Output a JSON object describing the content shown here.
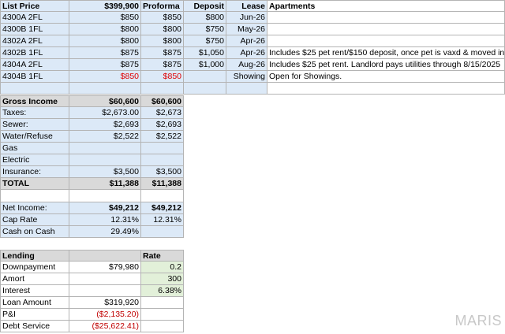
{
  "header": {
    "list_price_label": "List Price",
    "list_price": "$399,900",
    "proforma": "Proforma",
    "deposit": "Deposit",
    "lease": "Lease",
    "apartments": "Apartments"
  },
  "units": [
    {
      "unit": "4300A 2FL",
      "list": "$850",
      "proforma": "$850",
      "deposit": "$800",
      "lease": "Jun-26",
      "note": ""
    },
    {
      "unit": "4300B 1FL",
      "list": "$800",
      "proforma": "$800",
      "deposit": "$750",
      "lease": "May-26",
      "note": ""
    },
    {
      "unit": "4302A 2FL",
      "list": "$800",
      "proforma": "$800",
      "deposit": "$750",
      "lease": "Apr-26",
      "note": ""
    },
    {
      "unit": "4302B 1FL",
      "list": "$875",
      "proforma": "$875",
      "deposit": "$1,050",
      "lease": "Apr-26",
      "note": "Includes $25 pet rent/$150 deposit, once pet is vaxd & moved in"
    },
    {
      "unit": "4304A 2FL",
      "list": "$875",
      "proforma": "$875",
      "deposit": "$1,000",
      "lease": "Aug-26",
      "note": "Includes $25 pet rent. Landlord pays utilities through 8/15/2025"
    },
    {
      "unit": "4304B 1FL",
      "list": "$850",
      "proforma": "$850",
      "deposit": "",
      "lease": "Showing",
      "note": "Open for Showings."
    }
  ],
  "income": {
    "gross_label": "Gross Income",
    "gross_list": "$60,600",
    "gross_proforma": "$60,600",
    "expenses": [
      {
        "label": "Taxes:",
        "list": "$2,673.00",
        "proforma": "$2,673"
      },
      {
        "label": "Sewer:",
        "list": "$2,693",
        "proforma": "$2,693"
      },
      {
        "label": "Water/Refuse",
        "list": "$2,522",
        "proforma": "$2,522"
      },
      {
        "label": "Gas",
        "list": "",
        "proforma": ""
      },
      {
        "label": "Electric",
        "list": "",
        "proforma": ""
      },
      {
        "label": "Insurance:",
        "list": "$3,500",
        "proforma": "$3,500"
      }
    ],
    "total_label": "TOTAL",
    "total_list": "$11,388",
    "total_proforma": "$11,388",
    "net_label": "Net Income:",
    "net_list": "$49,212",
    "net_proforma": "$49,212",
    "cap_label": "Cap Rate",
    "cap_list": "12.31%",
    "cap_proforma": "12.31%",
    "coc_label": "Cash on Cash",
    "coc_list": "29.49%"
  },
  "lending": {
    "label": "Lending",
    "rate_label": "Rate",
    "rows": [
      {
        "label": "Downpayment",
        "value": "$79,980",
        "rate": "0.2"
      },
      {
        "label": "Amort",
        "value": "",
        "rate": "300"
      },
      {
        "label": "Interest",
        "value": "",
        "rate": "6.38%"
      },
      {
        "label": "Loan Amount",
        "value": "$319,920",
        "rate": ""
      },
      {
        "label": "P&I",
        "value": "($2,135.20)",
        "rate": ""
      },
      {
        "label": "Debt Service",
        "value": "($25,622.41)",
        "rate": ""
      }
    ]
  },
  "watermark": "MARIS"
}
